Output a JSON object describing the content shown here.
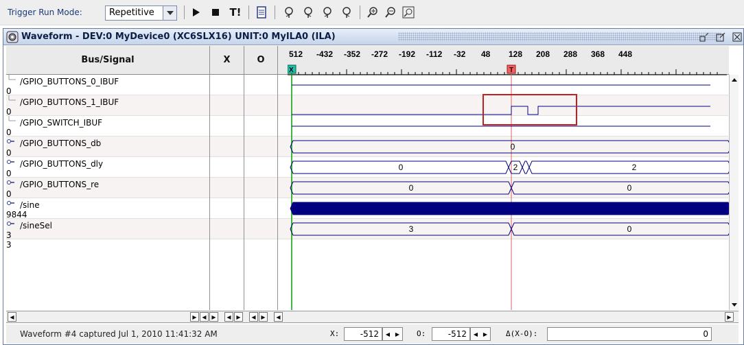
{
  "toolbar": {
    "trigger_label": "Trigger Run Mode:",
    "mode_value": "Repetitive",
    "icons": [
      "run-icon",
      "stop-icon",
      "trigger-immediate-icon",
      "data-window-icon",
      "prev-trigger-icon",
      "next-trigger-icon",
      "prev-marker-icon",
      "next-marker-icon",
      "zoom-in-icon",
      "zoom-out-icon",
      "zoom-fit-icon"
    ],
    "trigger_immediate": "T!"
  },
  "window": {
    "title": "Waveform - DEV:0 MyDevice0 (XC6SLX16) UNIT:0 MyILA0 (ILA)"
  },
  "columns": {
    "signal": "Bus/Signal",
    "x": "X",
    "o": "O"
  },
  "timeline": {
    "ticks": [
      "512",
      "-432",
      "-352",
      "-272",
      "-192",
      "-112",
      "-32",
      "48",
      "128",
      "208",
      "288",
      "368",
      "448"
    ],
    "x_marker": "X",
    "t_marker": "T"
  },
  "signals": [
    {
      "name": "/GPIO_BUTTONS_0_IBUF",
      "x": "0",
      "o": "0",
      "bus": false
    },
    {
      "name": "/GPIO_BUTTONS_1_IBUF",
      "x": "0",
      "o": "0",
      "bus": false,
      "selected": true
    },
    {
      "name": "/GPIO_SWITCH_IBUF",
      "x": "0",
      "o": "0",
      "bus": false
    },
    {
      "name": "/GPIO_BUTTONS_db",
      "x": "0",
      "o": "0",
      "bus": true
    },
    {
      "name": "/GPIO_BUTTONS_dly",
      "x": "0",
      "o": "0",
      "bus": true
    },
    {
      "name": "/GPIO_BUTTONS_re",
      "x": "0",
      "o": "0",
      "bus": true
    },
    {
      "name": "/sine",
      "x": "9844",
      "o": "9844",
      "bus": true
    },
    {
      "name": "/sineSel",
      "x": "3",
      "o": "3",
      "bus": true
    }
  ],
  "bus_values": {
    "db": "0",
    "dly_left": "0",
    "dly_mid": "2",
    "dly_right": "2",
    "re_left": "0",
    "re_right": "0",
    "sinesel_left": "3",
    "sinesel_right": "0"
  },
  "status": {
    "caption": "Waveform #4 captured Jul 1, 2010 11:41:32 AM",
    "x_label": "X:",
    "x_value": "-512",
    "o_label": "O:",
    "o_value": "-512",
    "delta_label": "Δ(X-O):",
    "delta_value": "0"
  },
  "colors": {
    "waveform": "#000080",
    "x_cursor": "#00a000",
    "t_cursor": "#e06060",
    "highlight_box": "#c02020"
  }
}
